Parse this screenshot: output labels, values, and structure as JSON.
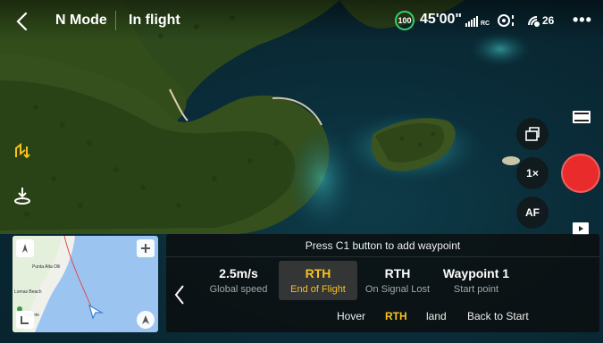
{
  "topbar": {
    "mode": "N Mode",
    "status": "In flight",
    "battery": "100",
    "flight_time": "45'00\"",
    "rc_label": "RC",
    "satellites": "26",
    "more": "•••"
  },
  "minimap": {
    "place1": "Punta Alta Olli",
    "place2": "Lomas Beach",
    "place3": "Puente"
  },
  "panel": {
    "hint": "Press C1 button to add waypoint",
    "settings": [
      {
        "value": "2.5m/s",
        "caption": "Global speed"
      },
      {
        "value": "RTH",
        "caption": "End of Flight"
      },
      {
        "value": "RTH",
        "caption": "On Signal Lost"
      },
      {
        "value": "Waypoint 1",
        "caption": "Start point"
      }
    ],
    "options": [
      "Hover",
      "RTH",
      "land",
      "Back to Start"
    ]
  },
  "camera": {
    "zoom": "1×",
    "focus": "AF"
  },
  "colors": {
    "accent": "#f6c21c",
    "battery": "#38d06a",
    "shutter": "#ea2b2b",
    "map_water": "#9cc4f0"
  }
}
